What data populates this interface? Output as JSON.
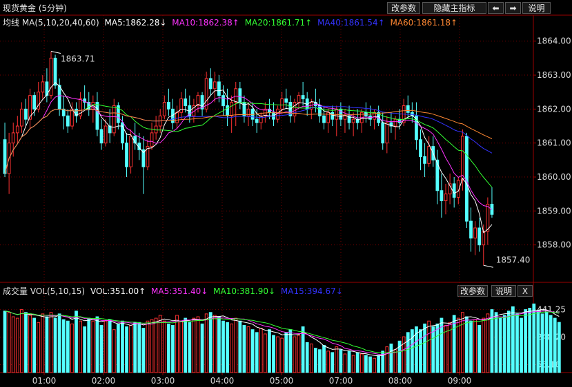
{
  "header": {
    "title": "现货黄金 (5分钟)",
    "buttons": {
      "change_params": "改参数",
      "hide_indicator": "隐藏主指标",
      "prev": "⬅",
      "next": "➡",
      "help": "说明"
    }
  },
  "ma_bar": {
    "label": "均线 MA(5,10,20,40,60)",
    "items": [
      {
        "text": "MA5:1862.28↓",
        "color": "#ffffff"
      },
      {
        "text": "MA10:1862.38↑",
        "color": "#ff33ff"
      },
      {
        "text": "MA20:1861.71↑",
        "color": "#33ff33"
      },
      {
        "text": "MA40:1861.54↑",
        "color": "#3333ff"
      },
      {
        "text": "MA60:1861.18↑",
        "color": "#ff8833"
      }
    ]
  },
  "vol_bar": {
    "label": "成交量 VOL(5,10,15)",
    "items": [
      {
        "text": "VOL:351.00↑",
        "color": "#ffffff"
      },
      {
        "text": "MA5:351.40↓",
        "color": "#ff33ff"
      },
      {
        "text": "MA10:381.90↓",
        "color": "#33ff33"
      },
      {
        "text": "MA15:394.67↓",
        "color": "#3333ff"
      }
    ],
    "buttons": {
      "change_params": "改参数",
      "help": "说明",
      "close": "X"
    }
  },
  "chart_data": [
    {
      "type": "candlestick",
      "price_ticks": [
        "1864.00",
        "1863.00",
        "1862.00",
        "1861.00",
        "1860.00",
        "1859.00",
        "1858.00"
      ],
      "ylim": [
        1857.0,
        1864.4
      ],
      "high_annotation": "1863.71",
      "low_annotation": "1857.40",
      "x_ticks": [
        "01:00",
        "02:00",
        "03:00",
        "04:00",
        "05:00",
        "07:00",
        "08:00",
        "09:00"
      ],
      "colors": {
        "up": "#ff3232",
        "down": "#54ffff"
      },
      "candles": [
        [
          1861.1,
          1861.6,
          1860.0,
          1860.1
        ],
        [
          1860.1,
          1861.3,
          1859.5,
          1861.0
        ],
        [
          1861.0,
          1861.6,
          1860.6,
          1861.3
        ],
        [
          1861.3,
          1861.8,
          1861.0,
          1861.5
        ],
        [
          1861.5,
          1862.2,
          1861.3,
          1862.0
        ],
        [
          1862.0,
          1862.3,
          1861.5,
          1861.7
        ],
        [
          1861.7,
          1862.6,
          1861.4,
          1862.4
        ],
        [
          1862.4,
          1862.5,
          1861.8,
          1862.0
        ],
        [
          1862.0,
          1862.8,
          1861.9,
          1862.5
        ],
        [
          1862.5,
          1863.0,
          1862.3,
          1862.8
        ],
        [
          1862.8,
          1863.2,
          1862.2,
          1862.4
        ],
        [
          1862.4,
          1863.7,
          1862.3,
          1863.5
        ],
        [
          1863.5,
          1863.6,
          1862.6,
          1862.7
        ],
        [
          1862.7,
          1862.9,
          1861.8,
          1862.0
        ],
        [
          1862.0,
          1862.4,
          1861.4,
          1861.8
        ],
        [
          1861.8,
          1862.0,
          1861.3,
          1861.5
        ],
        [
          1861.5,
          1862.2,
          1861.4,
          1862.0
        ],
        [
          1862.0,
          1862.2,
          1861.6,
          1861.8
        ],
        [
          1861.8,
          1862.5,
          1861.7,
          1862.3
        ],
        [
          1862.3,
          1862.7,
          1862.0,
          1862.2
        ],
        [
          1862.2,
          1862.5,
          1861.8,
          1862.0
        ],
        [
          1862.0,
          1862.4,
          1861.6,
          1862.2
        ],
        [
          1862.2,
          1862.5,
          1861.2,
          1861.4
        ],
        [
          1861.4,
          1861.7,
          1860.8,
          1861.0
        ],
        [
          1861.0,
          1861.7,
          1860.9,
          1861.5
        ],
        [
          1861.5,
          1862.0,
          1861.0,
          1861.3
        ],
        [
          1861.3,
          1862.3,
          1861.2,
          1862.1
        ],
        [
          1862.1,
          1862.2,
          1861.4,
          1861.6
        ],
        [
          1861.6,
          1861.8,
          1860.8,
          1861.0
        ],
        [
          1861.0,
          1861.3,
          1860.0,
          1860.3
        ],
        [
          1860.3,
          1861.4,
          1860.1,
          1861.2
        ],
        [
          1861.2,
          1861.6,
          1860.8,
          1861.0
        ],
        [
          1861.0,
          1861.3,
          1860.5,
          1860.8
        ],
        [
          1860.8,
          1861.2,
          1859.5,
          1860.3
        ],
        [
          1860.3,
          1861.1,
          1860.2,
          1860.9
        ],
        [
          1860.9,
          1861.6,
          1860.8,
          1861.3
        ],
        [
          1861.3,
          1861.8,
          1861.1,
          1861.5
        ],
        [
          1861.5,
          1862.0,
          1861.3,
          1861.8
        ],
        [
          1861.8,
          1862.4,
          1861.7,
          1862.2
        ],
        [
          1862.2,
          1862.6,
          1861.8,
          1862.0
        ],
        [
          1862.0,
          1862.3,
          1861.4,
          1861.6
        ],
        [
          1861.6,
          1862.1,
          1861.4,
          1861.9
        ],
        [
          1861.9,
          1862.5,
          1861.7,
          1862.3
        ],
        [
          1862.3,
          1862.6,
          1861.9,
          1862.1
        ],
        [
          1862.1,
          1862.4,
          1861.6,
          1861.8
        ],
        [
          1861.8,
          1862.3,
          1861.6,
          1862.1
        ],
        [
          1862.1,
          1862.5,
          1861.9,
          1862.4
        ],
        [
          1862.4,
          1862.5,
          1861.8,
          1862.0
        ],
        [
          1862.0,
          1863.1,
          1861.9,
          1862.9
        ],
        [
          1862.9,
          1863.2,
          1862.4,
          1862.6
        ],
        [
          1862.6,
          1863.1,
          1862.2,
          1862.8
        ],
        [
          1862.8,
          1863.0,
          1862.2,
          1862.4
        ],
        [
          1862.4,
          1862.7,
          1861.8,
          1862.1
        ],
        [
          1862.1,
          1862.6,
          1861.5,
          1861.8
        ],
        [
          1861.8,
          1862.4,
          1861.3,
          1862.2
        ],
        [
          1862.2,
          1862.8,
          1861.5,
          1862.6
        ],
        [
          1862.6,
          1862.8,
          1862.0,
          1862.2
        ],
        [
          1862.2,
          1862.4,
          1861.6,
          1861.8
        ],
        [
          1861.8,
          1862.2,
          1861.5,
          1862.0
        ],
        [
          1862.0,
          1862.2,
          1861.5,
          1861.7
        ],
        [
          1861.7,
          1862.0,
          1861.3,
          1861.6
        ],
        [
          1861.6,
          1861.9,
          1861.4,
          1861.8
        ],
        [
          1861.8,
          1862.2,
          1861.6,
          1862.0
        ],
        [
          1862.0,
          1862.3,
          1861.7,
          1861.9
        ],
        [
          1861.9,
          1862.2,
          1861.5,
          1861.7
        ],
        [
          1861.7,
          1862.1,
          1861.6,
          1862.0
        ],
        [
          1862.0,
          1862.5,
          1861.9,
          1862.3
        ],
        [
          1862.3,
          1862.6,
          1862.0,
          1862.2
        ],
        [
          1862.2,
          1862.4,
          1861.6,
          1861.8
        ],
        [
          1861.8,
          1862.3,
          1861.6,
          1862.2
        ],
        [
          1862.2,
          1862.5,
          1862.0,
          1862.4
        ],
        [
          1862.4,
          1862.8,
          1862.1,
          1862.3
        ],
        [
          1862.3,
          1862.5,
          1861.8,
          1862.0
        ],
        [
          1862.0,
          1862.3,
          1861.7,
          1862.2
        ],
        [
          1862.2,
          1862.6,
          1861.9,
          1862.1
        ],
        [
          1862.1,
          1862.3,
          1861.6,
          1861.8
        ],
        [
          1861.8,
          1862.1,
          1861.4,
          1861.6
        ],
        [
          1861.6,
          1862.0,
          1861.3,
          1861.9
        ],
        [
          1861.9,
          1862.1,
          1861.5,
          1861.7
        ],
        [
          1861.7,
          1862.1,
          1861.2,
          1862.0
        ],
        [
          1862.0,
          1862.2,
          1861.5,
          1861.7
        ],
        [
          1861.7,
          1862.0,
          1861.3,
          1861.8
        ],
        [
          1861.8,
          1862.1,
          1861.4,
          1861.6
        ],
        [
          1861.6,
          1861.9,
          1861.2,
          1861.7
        ],
        [
          1861.7,
          1862.0,
          1861.4,
          1861.6
        ],
        [
          1861.6,
          1862.0,
          1861.3,
          1861.9
        ],
        [
          1861.9,
          1862.2,
          1861.6,
          1861.8
        ],
        [
          1861.8,
          1862.1,
          1861.5,
          1861.7
        ],
        [
          1861.7,
          1862.0,
          1861.4,
          1861.9
        ],
        [
          1861.9,
          1862.1,
          1861.5,
          1861.6
        ],
        [
          1861.6,
          1861.9,
          1860.8,
          1861.0
        ],
        [
          1861.0,
          1861.8,
          1860.7,
          1861.6
        ],
        [
          1861.6,
          1861.9,
          1861.3,
          1861.5
        ],
        [
          1861.5,
          1861.8,
          1861.1,
          1861.7
        ],
        [
          1861.7,
          1862.0,
          1861.4,
          1861.6
        ],
        [
          1861.6,
          1862.3,
          1861.5,
          1862.1
        ],
        [
          1862.1,
          1862.4,
          1861.7,
          1861.9
        ],
        [
          1861.9,
          1862.2,
          1861.6,
          1861.8
        ],
        [
          1861.8,
          1862.2,
          1860.8,
          1861.1
        ],
        [
          1861.1,
          1861.4,
          1860.2,
          1860.6
        ],
        [
          1860.6,
          1861.0,
          1860.0,
          1860.4
        ],
        [
          1860.4,
          1861.2,
          1860.3,
          1860.9
        ],
        [
          1860.9,
          1861.2,
          1860.3,
          1860.5
        ],
        [
          1860.5,
          1860.8,
          1859.2,
          1859.6
        ],
        [
          1859.6,
          1860.1,
          1858.8,
          1859.3
        ],
        [
          1859.3,
          1859.8,
          1858.9,
          1859.5
        ],
        [
          1859.5,
          1860.1,
          1859.2,
          1859.8
        ],
        [
          1859.8,
          1860.0,
          1859.1,
          1859.4
        ],
        [
          1859.4,
          1860.0,
          1859.2,
          1859.9
        ],
        [
          1859.9,
          1861.4,
          1859.6,
          1861.2
        ],
        [
          1861.2,
          1861.3,
          1858.5,
          1858.7
        ],
        [
          1858.7,
          1859.1,
          1857.8,
          1858.2
        ],
        [
          1858.2,
          1858.7,
          1857.7,
          1858.5
        ],
        [
          1858.5,
          1858.8,
          1857.8,
          1858.0
        ],
        [
          1858.0,
          1858.6,
          1857.4,
          1858.4
        ],
        [
          1858.4,
          1859.4,
          1858.0,
          1859.2
        ],
        [
          1859.2,
          1859.7,
          1858.8,
          1858.9
        ]
      ]
    },
    {
      "type": "bar",
      "vol_ticks": [
        "441.25",
        "248.20",
        "55.16"
      ],
      "ylim": [
        0,
        520
      ],
      "last_volume": 351.0,
      "volumes": [
        430,
        420,
        390,
        380,
        440,
        420,
        400,
        380,
        350,
        410,
        390,
        420,
        380,
        410,
        370,
        360,
        340,
        430,
        360,
        320,
        380,
        360,
        390,
        330,
        360,
        370,
        300,
        340,
        360,
        320,
        330,
        350,
        350,
        310,
        360,
        370,
        380,
        400,
        360,
        340,
        330,
        400,
        360,
        380,
        350,
        380,
        390,
        340,
        410,
        420,
        400,
        390,
        360,
        350,
        340,
        380,
        360,
        330,
        320,
        300,
        280,
        310,
        270,
        300,
        260,
        250,
        240,
        280,
        300,
        250,
        260,
        320,
        210,
        200,
        170,
        160,
        190,
        150,
        140,
        180,
        160,
        130,
        150,
        120,
        140,
        130,
        120,
        110,
        100,
        120,
        150,
        180,
        200,
        160,
        220,
        250,
        280,
        300,
        320,
        300,
        340,
        360,
        320,
        340,
        380,
        330,
        350,
        400,
        380,
        420,
        390,
        360,
        370,
        330,
        380,
        410,
        440,
        420,
        380,
        400,
        430,
        460,
        410,
        380,
        440,
        450,
        480,
        430,
        410,
        420,
        400,
        380,
        351
      ]
    }
  ]
}
